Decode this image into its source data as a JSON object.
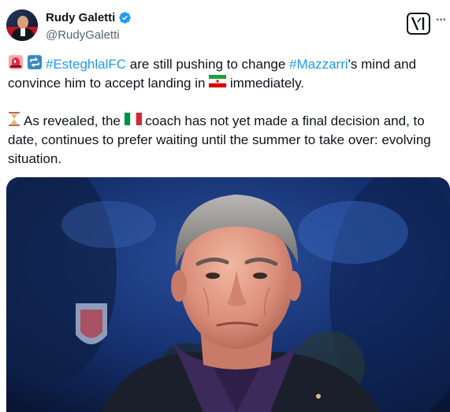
{
  "author": {
    "display_name": "Rudy Galetti",
    "handle": "@RudyGaletti",
    "verified_icon": "verified-badge-icon"
  },
  "header_icons": {
    "x_logo": "x-logo-icon",
    "more": "more-icon",
    "more_glyph": "···"
  },
  "tweet": {
    "line1_hashtag1": "#EsteghlalFC",
    "line1_mid": " are still pushing to change ",
    "line1_hashtag2": "#Mazzarri",
    "line1_end": "'s mind and",
    "line2_start": "convince him to accept landing in ",
    "line2_end": " immediately.",
    "line3_start": "As revealed, the ",
    "line3_end": " coach has not yet made a final decision and, to",
    "line4": "date, continues to prefer waiting until the summer to take over: evolving",
    "line5": "situation.",
    "emojis": [
      "rotating-light-icon",
      "repeat-arrows-icon",
      "iran-flag-icon",
      "hourglass-icon",
      "italy-flag-icon"
    ]
  },
  "colors": {
    "hashtag": "#1d9bf0",
    "verified": "#1d9bf0",
    "text": "#0f1419",
    "secondary": "#536471"
  }
}
